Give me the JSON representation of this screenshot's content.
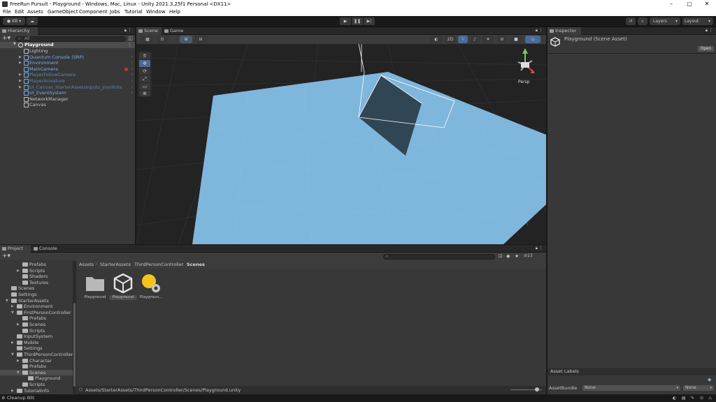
{
  "window": {
    "title": "FreeRun Pursuit - Playground - Windows, Mac, Linux - Unity 2021.3.25f1 Personal <DX11>",
    "controls": [
      "–",
      "▢",
      "✕"
    ]
  },
  "menu": [
    "File",
    "Edit",
    "Assets",
    "GameObject",
    "Component",
    "Jobs",
    "Tutorial",
    "Window",
    "Help"
  ],
  "toolbar": {
    "account": "KB",
    "layers": "Layers",
    "layout": "Layout"
  },
  "hierarchy": {
    "tab": "Hierarchy",
    "search_placeholder": "All",
    "scene": "Playground",
    "items": [
      {
        "label": "Lighting",
        "style": "normal"
      },
      {
        "label": "Quantum Console (SRP)",
        "style": "blue"
      },
      {
        "label": "Environment",
        "style": "blue"
      },
      {
        "label": "MainCamera",
        "style": "blue"
      },
      {
        "label": "PlayerFollowCamera",
        "style": "faded"
      },
      {
        "label": "PlayerArmature",
        "style": "faded"
      },
      {
        "label": "UI_Canvas_StarterAssetsInputs_Joysticks",
        "style": "faded"
      },
      {
        "label": "UI_EventSystem",
        "style": "blue"
      },
      {
        "label": "NetworkManager",
        "style": "normal"
      },
      {
        "label": "Canvas",
        "style": "normal"
      }
    ]
  },
  "scene_view": {
    "tabs": [
      "Scene",
      "Game"
    ],
    "toggle_2d": "2D",
    "persp_label": "Persp",
    "colors": {
      "ground": "#7fb6dc",
      "grid_bg": "#222222"
    }
  },
  "inspector": {
    "tab": "Inspector",
    "object": "Playground (Scene Asset)",
    "open_button": "Open",
    "asset_labels": "Asset Labels",
    "asset_bundle_label": "AssetBundle",
    "asset_bundle_value": "None",
    "asset_variant_value": "None"
  },
  "project": {
    "tabs": [
      "Project",
      "Console"
    ],
    "breadcrumb": [
      "Assets",
      "StarterAssets",
      "ThirdPersonController",
      "Scenes"
    ],
    "hidden_count": "13",
    "tree": [
      {
        "label": "Prefabs",
        "indent": 3
      },
      {
        "label": "Scripts",
        "indent": 3,
        "arrow": true
      },
      {
        "label": "Shaders",
        "indent": 3
      },
      {
        "label": "Textures",
        "indent": 3
      },
      {
        "label": "Scenes",
        "indent": 1
      },
      {
        "label": "Settings",
        "indent": 1
      },
      {
        "label": "StarterAssets",
        "indent": 1,
        "arrow": true,
        "open": true
      },
      {
        "label": "Environment",
        "indent": 2,
        "arrow": true
      },
      {
        "label": "FirstPersonController",
        "indent": 2,
        "arrow": true,
        "open": true
      },
      {
        "label": "Prefabs",
        "indent": 3
      },
      {
        "label": "Scenes",
        "indent": 3,
        "arrow": true
      },
      {
        "label": "Scripts",
        "indent": 3
      },
      {
        "label": "InputSystem",
        "indent": 2
      },
      {
        "label": "Mobile",
        "indent": 2,
        "arrow": true
      },
      {
        "label": "Settings",
        "indent": 2
      },
      {
        "label": "ThirdPersonController",
        "indent": 2,
        "arrow": true,
        "open": true
      },
      {
        "label": "Character",
        "indent": 3,
        "arrow": true
      },
      {
        "label": "Prefabs",
        "indent": 3
      },
      {
        "label": "Scenes",
        "indent": 3,
        "arrow": true,
        "open": true,
        "selected": true
      },
      {
        "label": "Playground",
        "indent": 4
      },
      {
        "label": "Scripts",
        "indent": 3
      },
      {
        "label": "TutorialInfo",
        "indent": 2,
        "arrow": true
      }
    ],
    "assets": [
      {
        "label": "Playground",
        "icon": "folder-icon"
      },
      {
        "label": "Playground",
        "icon": "unity-scene-icon",
        "selected": true
      },
      {
        "label": "Playgroun...",
        "icon": "lighting-settings-icon"
      }
    ],
    "path": "Assets/StarterAssets/ThirdPersonController/Scenes/Playground.unity"
  },
  "status": "Cleanup Blit"
}
